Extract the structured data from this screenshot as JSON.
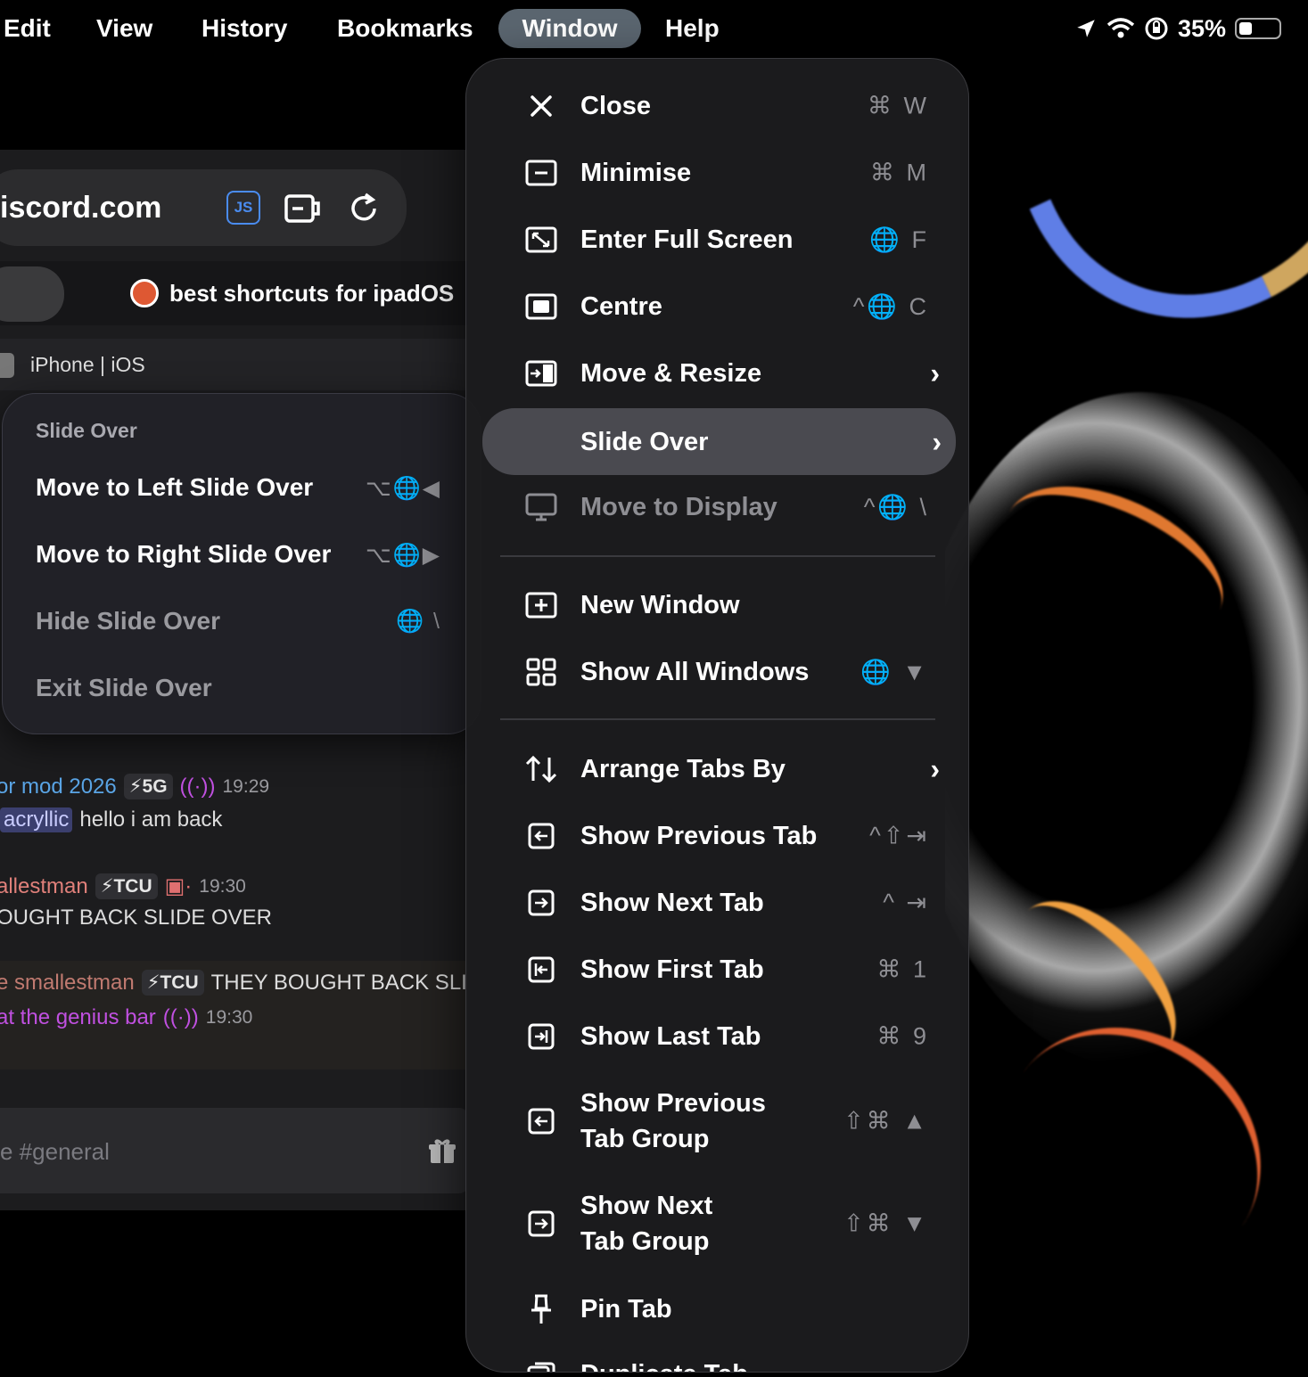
{
  "menubar": {
    "items": [
      "Edit",
      "View",
      "History",
      "Bookmarks",
      "Window",
      "Help"
    ],
    "active": "Window"
  },
  "status": {
    "battery": "35%"
  },
  "browser": {
    "url": "iscord.com",
    "js_badge": "JS",
    "tab_label": "best shortcuts for ipadOS",
    "channel": "iPhone | iOS",
    "input_placeholder": "e #general"
  },
  "chat": {
    "m1_name": "or mod 2026",
    "m1_tag": "⚡5G",
    "m1_time": "19:29",
    "m1_mention": "acryllic",
    "m1_text": "hello i am back",
    "m2_name": "allestman",
    "m2_tag": "⚡TCU",
    "m2_time": "19:30",
    "m2_text": "OUGHT BACK SLIDE OVER",
    "reply_name": "e smallestman",
    "reply_tag": "⚡TCU",
    "reply_text": "THEY BOUGHT BACK SLIDE",
    "m3_name": "at the genius bar",
    "m3_time": "19:30"
  },
  "submenu": {
    "header": "Slide Over",
    "items": [
      {
        "label": "Move to Left Slide Over",
        "shortcut": "⌥🌐◀"
      },
      {
        "label": "Move to Right Slide Over",
        "shortcut": "⌥🌐▶"
      },
      {
        "label": "Hide Slide Over",
        "shortcut": "🌐 \\"
      },
      {
        "label": "Exit Slide Over",
        "shortcut": ""
      }
    ]
  },
  "window_menu": {
    "items": [
      {
        "label": "Close",
        "shortcut": "⌘ W",
        "icon": "close-icon"
      },
      {
        "label": "Minimise",
        "shortcut": "⌘ M",
        "icon": "minimise-icon"
      },
      {
        "label": "Enter Full Screen",
        "shortcut": "🌐 F",
        "icon": "fullscreen-icon"
      },
      {
        "label": "Centre",
        "shortcut": "^🌐 C",
        "icon": "centre-icon"
      },
      {
        "label": "Move & Resize",
        "shortcut": "",
        "icon": "move-resize-icon"
      },
      {
        "label": "Slide Over",
        "shortcut": "",
        "icon": ""
      },
      {
        "label": "Move to Display",
        "shortcut": "^🌐 \\",
        "icon": "display-icon"
      },
      {
        "label": "New Window",
        "shortcut": "",
        "icon": "new-window-icon"
      },
      {
        "label": "Show All Windows",
        "shortcut": "🌐 ▼",
        "icon": "grid-icon"
      },
      {
        "label": "Arrange Tabs By",
        "shortcut": "",
        "icon": "sort-arrows-icon"
      },
      {
        "label": "Show Previous Tab",
        "shortcut": "^⇧⇥",
        "icon": "previous-tab-icon"
      },
      {
        "label": "Show Next Tab",
        "shortcut": "^ ⇥",
        "icon": "next-tab-icon"
      },
      {
        "label": "Show First Tab",
        "shortcut": "⌘ 1",
        "icon": "first-tab-icon"
      },
      {
        "label": "Show Last Tab",
        "shortcut": "⌘ 9",
        "icon": "last-tab-icon"
      },
      {
        "label": "Show Previous\nTab Group",
        "shortcut": "⇧⌘ ▲",
        "icon": "previous-group-icon"
      },
      {
        "label": "Show Next\nTab Group",
        "shortcut": "⇧⌘ ▼",
        "icon": "next-group-icon"
      },
      {
        "label": "Pin Tab",
        "shortcut": "",
        "icon": "pin-icon"
      },
      {
        "label": "Duplicate Tab",
        "shortcut": "",
        "icon": "duplicate-icon"
      }
    ]
  }
}
